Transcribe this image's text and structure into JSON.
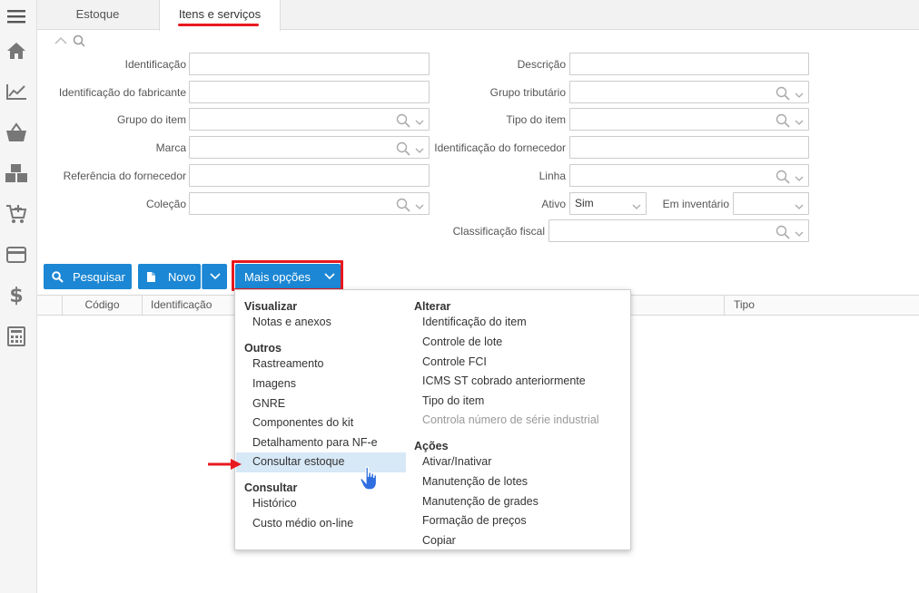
{
  "sidebar": {
    "icons": [
      "menu-icon",
      "home-icon",
      "chart-icon",
      "basket-icon",
      "boxes-icon",
      "cart-add-icon",
      "card-icon",
      "dollar-icon",
      "calculator-icon"
    ]
  },
  "tabs": [
    {
      "label": "Estoque",
      "active": false
    },
    {
      "label": "Itens e serviços",
      "active": true
    }
  ],
  "filters": {
    "left": [
      {
        "label": "Identificação",
        "value": "",
        "lookup": false
      },
      {
        "label": "Identificação do fabricante",
        "value": "",
        "lookup": false
      },
      {
        "label": "Grupo do item",
        "value": "",
        "lookup": true
      },
      {
        "label": "Marca",
        "value": "",
        "lookup": true
      },
      {
        "label": "Referência do fornecedor",
        "value": "",
        "lookup": false
      },
      {
        "label": "Coleção",
        "value": "",
        "lookup": true
      }
    ],
    "right": [
      {
        "label": "Descrição",
        "value": "",
        "lookup": false
      },
      {
        "label": "Grupo tributário",
        "value": "",
        "lookup": true
      },
      {
        "label": "Tipo do item",
        "value": "",
        "lookup": true
      },
      {
        "label": "Identificação do fornecedor",
        "value": "",
        "lookup": false
      },
      {
        "label": "Linha",
        "value": "",
        "lookup": true
      }
    ],
    "ativo": {
      "label": "Ativo",
      "value": "Sim"
    },
    "em_inventario": {
      "label": "Em inventário",
      "value": ""
    },
    "classificacao": {
      "label": "Classificação fiscal",
      "value": ""
    }
  },
  "toolbar": {
    "search_label": "Pesquisar",
    "new_label": "Novo",
    "more_label": "Mais opções"
  },
  "grid": {
    "columns": [
      "Código",
      "Identificação",
      "Tipo"
    ]
  },
  "menu": {
    "left": [
      {
        "header": "Visualizar",
        "items": [
          {
            "label": "Notas e anexos"
          }
        ]
      },
      {
        "header": "Outros",
        "items": [
          {
            "label": "Rastreamento"
          },
          {
            "label": "Imagens"
          },
          {
            "label": "GNRE"
          },
          {
            "label": "Componentes do kit"
          },
          {
            "label": "Detalhamento para NF-e"
          },
          {
            "label": "Consultar estoque",
            "highlighted": true
          }
        ]
      },
      {
        "header": "Consultar",
        "items": [
          {
            "label": "Histórico"
          },
          {
            "label": "Custo médio on-line"
          }
        ]
      }
    ],
    "right": [
      {
        "header": "Alterar",
        "items": [
          {
            "label": "Identificação do item"
          },
          {
            "label": "Controle de lote"
          },
          {
            "label": "Controle FCI"
          },
          {
            "label": "ICMS ST cobrado anteriormente"
          },
          {
            "label": "Tipo do item"
          },
          {
            "label": "Controla número de série industrial",
            "disabled": true
          }
        ]
      },
      {
        "header": "Ações",
        "items": [
          {
            "label": "Ativar/Inativar"
          },
          {
            "label": "Manutenção de lotes"
          },
          {
            "label": "Manutenção de grades"
          },
          {
            "label": "Formação de preços"
          },
          {
            "label": "Copiar"
          }
        ]
      }
    ]
  },
  "colors": {
    "accent": "#1c87d4",
    "highlight": "#e8191f",
    "menu_hover": "#d7e8f6"
  }
}
